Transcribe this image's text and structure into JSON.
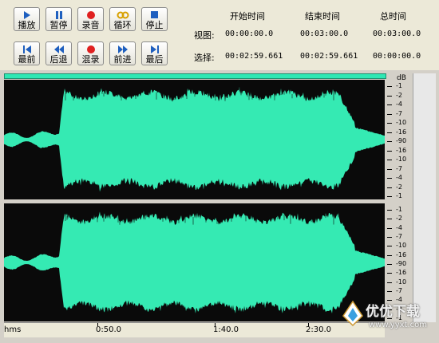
{
  "toolbar": {
    "buttons_row1": [
      {
        "label": "播放",
        "icon": "play-icon"
      },
      {
        "label": "暂停",
        "icon": "pause-icon"
      },
      {
        "label": "录音",
        "icon": "record-icon"
      },
      {
        "label": "循环",
        "icon": "loop-icon"
      },
      {
        "label": "停止",
        "icon": "stop-icon"
      }
    ],
    "buttons_row2": [
      {
        "label": "最前",
        "icon": "skip-to-start-icon"
      },
      {
        "label": "后退",
        "icon": "rewind-icon"
      },
      {
        "label": "混录",
        "icon": "mix-record-icon"
      },
      {
        "label": "前进",
        "icon": "fast-forward-icon"
      },
      {
        "label": "最后",
        "icon": "skip-to-end-icon"
      }
    ]
  },
  "time_panel": {
    "headers": [
      "开始时间",
      "结束时间",
      "总时间"
    ],
    "rows": [
      {
        "label": "视图:",
        "start": "00:00:00.0",
        "end": "00:03:00.0",
        "total": "00:03:00.0"
      },
      {
        "label": "选择:",
        "start": "00:02:59.661",
        "end": "00:02:59.661",
        "total": "00:00:00.0"
      }
    ]
  },
  "scale": {
    "unit": "dB",
    "labels": [
      "-1",
      "-2",
      "-4",
      "-7",
      "-10",
      "-16",
      "-90",
      "-16",
      "-10",
      "-7",
      "-4",
      "-2",
      "-1"
    ]
  },
  "ruler": {
    "unit": "hms",
    "labels": [
      "0:50.0",
      "1:40.0",
      "2:30.0"
    ]
  },
  "watermark": {
    "text": "优优下载",
    "url": "www.yyxt.com"
  },
  "colors": {
    "waveform": "#35eab3",
    "background": "#0a0a0a",
    "accent_blue": "#1f5fbf",
    "record_red": "#e02020"
  }
}
